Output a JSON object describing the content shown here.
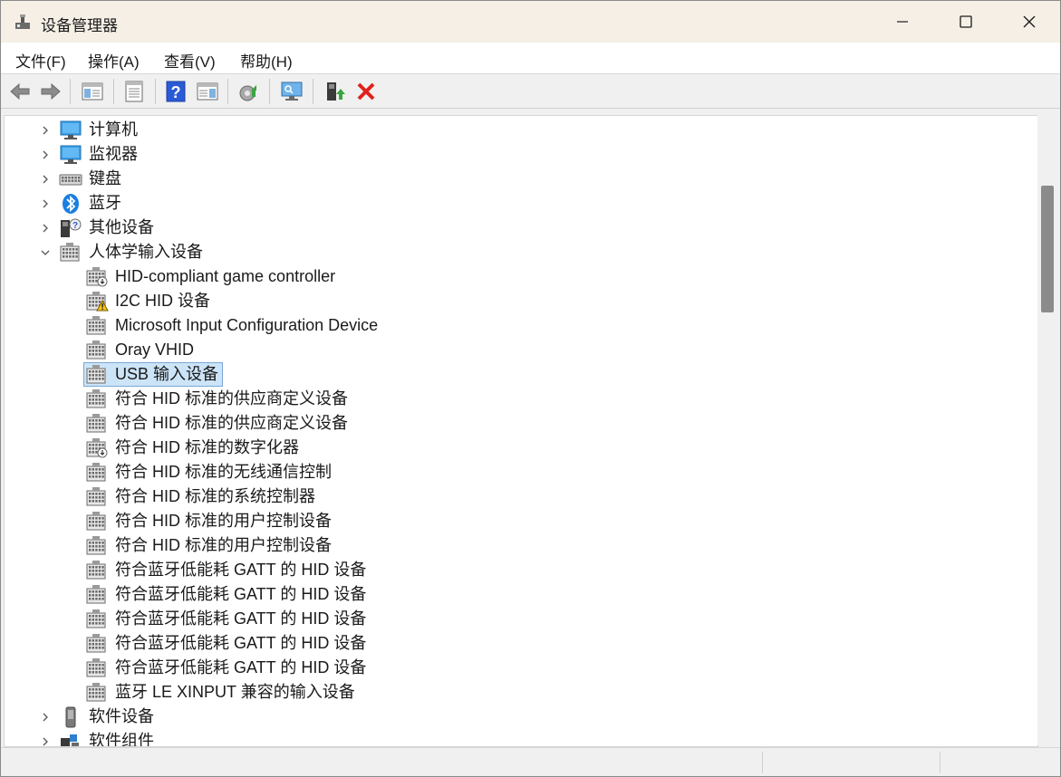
{
  "window": {
    "title": "设备管理器"
  },
  "menu": {
    "items": [
      "文件(F)",
      "操作(A)",
      "查看(V)",
      "帮助(H)"
    ]
  },
  "toolbar": {
    "buttons": [
      "back-icon",
      "forward-icon",
      "show-hide-console-tree-icon",
      "properties-icon",
      "help-icon",
      "action-pane-icon",
      "update-driver-icon",
      "scan-hardware-icon",
      "enable-device-icon",
      "uninstall-device-icon"
    ]
  },
  "tree": {
    "categories_top": [
      {
        "label": "计算机",
        "icon": "computer-icon",
        "expanded": false
      },
      {
        "label": "监视器",
        "icon": "monitor-icon",
        "expanded": false
      },
      {
        "label": "键盘",
        "icon": "keyboard-icon",
        "expanded": false
      },
      {
        "label": "蓝牙",
        "icon": "bluetooth-icon",
        "expanded": false
      },
      {
        "label": "其他设备",
        "icon": "other-devices-icon",
        "expanded": false
      },
      {
        "label": "人体学输入设备",
        "icon": "hid-icon",
        "expanded": true
      }
    ],
    "hid_children": [
      {
        "label": "HID-compliant game controller",
        "icon": "game-controller-icon",
        "status": "normal"
      },
      {
        "label": "I2C HID 设备",
        "icon": "hid-warning-icon",
        "status": "warning"
      },
      {
        "label": "Microsoft Input Configuration Device",
        "icon": "hid-icon",
        "status": "normal"
      },
      {
        "label": "Oray VHID",
        "icon": "hid-icon",
        "status": "normal"
      },
      {
        "label": "USB 输入设备",
        "icon": "hid-icon",
        "status": "selected"
      },
      {
        "label": "符合 HID 标准的供应商定义设备",
        "icon": "hid-icon",
        "status": "normal"
      },
      {
        "label": "符合 HID 标准的供应商定义设备",
        "icon": "hid-icon",
        "status": "normal"
      },
      {
        "label": "符合 HID 标准的数字化器",
        "icon": "game-controller-icon",
        "status": "normal"
      },
      {
        "label": "符合 HID 标准的无线通信控制",
        "icon": "hid-icon",
        "status": "normal"
      },
      {
        "label": "符合 HID 标准的系统控制器",
        "icon": "hid-icon",
        "status": "normal"
      },
      {
        "label": "符合 HID 标准的用户控制设备",
        "icon": "hid-icon",
        "status": "normal"
      },
      {
        "label": "符合 HID 标准的用户控制设备",
        "icon": "hid-icon",
        "status": "normal"
      },
      {
        "label": "符合蓝牙低能耗 GATT 的 HID 设备",
        "icon": "hid-icon",
        "status": "normal"
      },
      {
        "label": "符合蓝牙低能耗 GATT 的 HID 设备",
        "icon": "hid-icon",
        "status": "normal"
      },
      {
        "label": "符合蓝牙低能耗 GATT 的 HID 设备",
        "icon": "hid-icon",
        "status": "normal"
      },
      {
        "label": "符合蓝牙低能耗 GATT 的 HID 设备",
        "icon": "hid-icon",
        "status": "normal"
      },
      {
        "label": "符合蓝牙低能耗 GATT 的 HID 设备",
        "icon": "hid-icon",
        "status": "normal"
      },
      {
        "label": "蓝牙 LE XINPUT 兼容的输入设备",
        "icon": "hid-icon",
        "status": "normal"
      }
    ],
    "categories_bottom": [
      {
        "label": "软件设备",
        "icon": "software-device-icon",
        "expanded": false
      },
      {
        "label": "软件组件",
        "icon": "software-component-icon",
        "expanded": false
      }
    ]
  },
  "colors": {
    "titlebar": "#f5efe6",
    "selection_bg": "#cce4f7",
    "selection_border": "#7aa7d6",
    "uninstall_red": "#e0211d",
    "help_blue": "#2a5bd7"
  }
}
